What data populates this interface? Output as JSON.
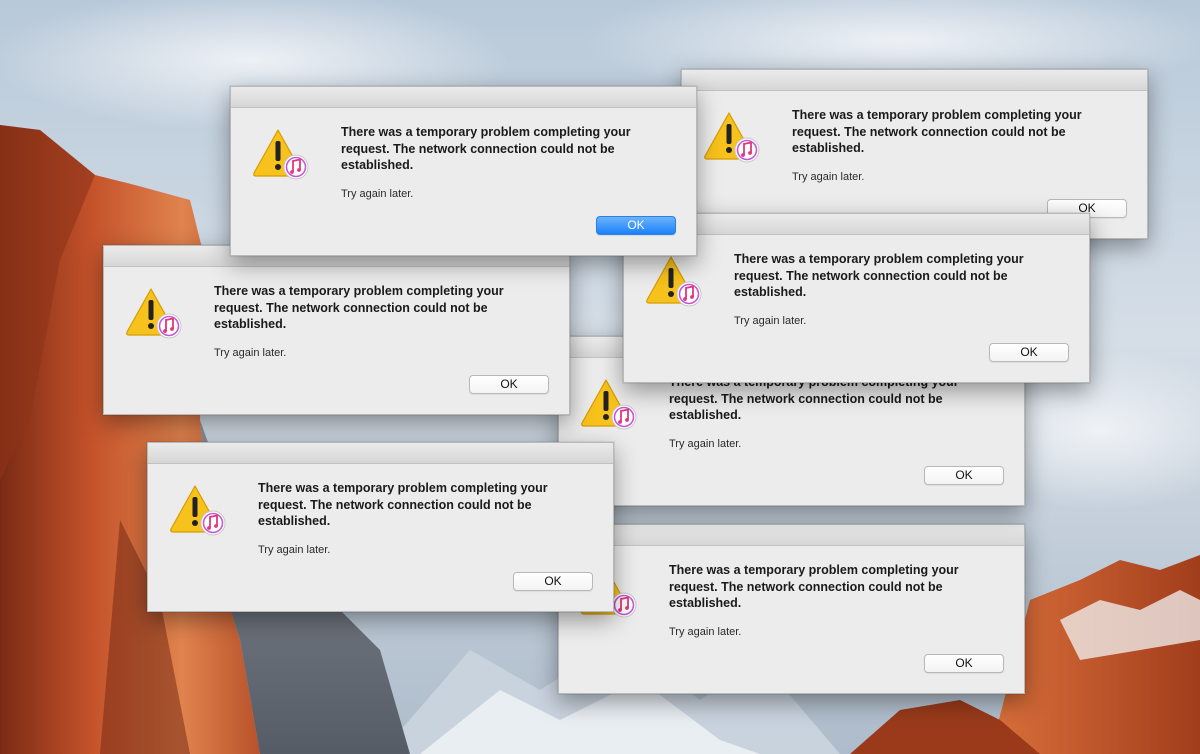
{
  "dialog": {
    "message": "There was a temporary problem completing your\nrequest. The network connection could not be\nestablished.",
    "detail": "Try again later.",
    "ok_label": "OK",
    "icon": "alert-triangle-with-itunes-badge-icon"
  },
  "colors": {
    "default_button": "#1b82fb",
    "alert_yellow": "#f7c21b",
    "dialog_background": "#ececec"
  }
}
